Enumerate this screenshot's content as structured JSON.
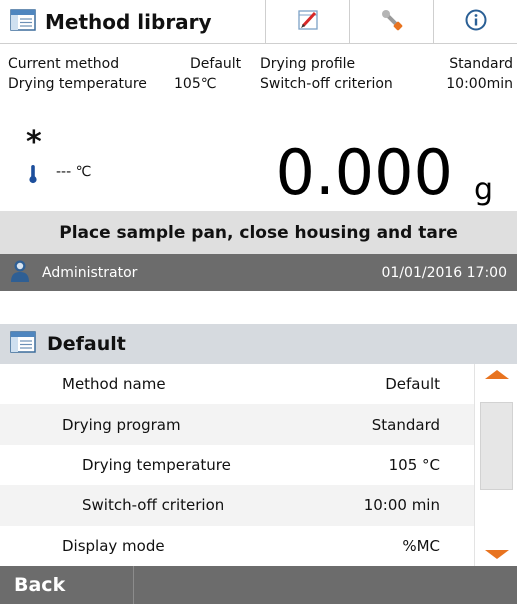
{
  "titlebar": {
    "title": "Method library",
    "icons": [
      "method-library-icon",
      "edit-icon",
      "wrench-icon",
      "info-icon"
    ]
  },
  "method_info": {
    "current_method_label": "Current method",
    "current_method_value": "Default",
    "drying_profile_label": "Drying profile",
    "drying_profile_value": "Standard",
    "drying_temperature_label": "Drying temperature",
    "drying_temperature_value": "105℃",
    "switch_off_label": "Switch-off criterion",
    "switch_off_value": "10:00min"
  },
  "reading": {
    "stability_mark": "*",
    "temperature": "--- ℃",
    "weight": "0.000",
    "unit": "g"
  },
  "instruction": "Place sample pan, close housing and tare",
  "status": {
    "user": "Administrator",
    "datetime": "01/01/2016 17:00"
  },
  "section": {
    "title": "Default",
    "rows": [
      {
        "label": "Method name",
        "value": "Default",
        "indent": 0
      },
      {
        "label": "Drying program",
        "value": "Standard",
        "indent": 0
      },
      {
        "label": "Drying temperature",
        "value": "105 °C",
        "indent": 1
      },
      {
        "label": "Switch-off criterion",
        "value": "10:00 min",
        "indent": 1
      },
      {
        "label": "Display mode",
        "value": "%MC",
        "indent": 0
      }
    ]
  },
  "footer": {
    "back_label": "Back"
  },
  "colors": {
    "accent": "#e8731f",
    "statusbar": "#6c6c6c",
    "header_bg": "#d6dadf",
    "instruction_bg": "#dfdfdf"
  }
}
